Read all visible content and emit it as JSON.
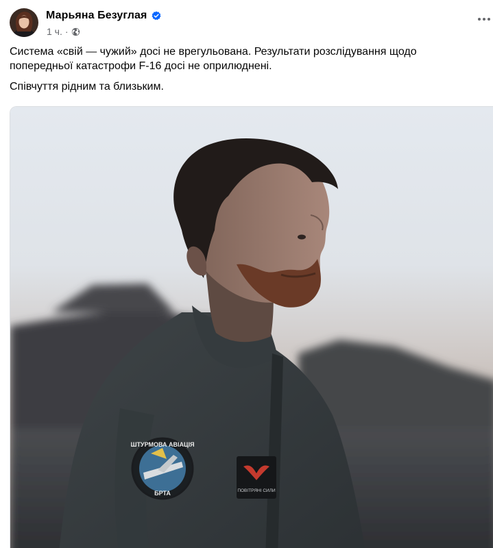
{
  "author": {
    "name": "Марьяна Безуглая",
    "verified": true,
    "avatar_icon": "avatar-portrait"
  },
  "post_meta": {
    "time": "1 ч.",
    "separator": "·",
    "audience_icon": "globe-icon"
  },
  "menu_icon": "more-horizontal-icon",
  "text": {
    "paragraph_1": "Система «свій — чужий» досі не врегульована. Результати розслідування щодо попередньої катастрофи F-16 досі не оприлюднені.",
    "paragraph_2": "Співчуття рідним та близьким."
  },
  "photo": {
    "patch_left_text_top": "ШТУРМОВА АВІАЦІЯ",
    "patch_left_text_bottom": "БРТА",
    "patch_right_text": "ПОВІТРЯНІ СИЛИ"
  },
  "colors": {
    "text_primary": "#050505",
    "text_secondary": "#65676b",
    "verified_blue": "#0866ff",
    "divider": "#dadde1"
  }
}
